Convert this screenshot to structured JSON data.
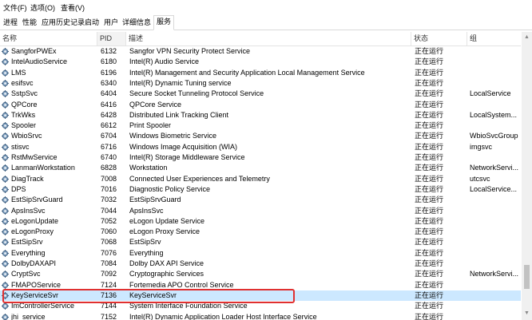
{
  "menu": {
    "file": "文件(F)",
    "options": "选项(O)",
    "view": "查看(V)"
  },
  "tabs": [
    "进程",
    "性能",
    "应用历史记录",
    "启动",
    "用户",
    "详细信息",
    "服务"
  ],
  "columns": {
    "name": "名称",
    "pid": "PID",
    "desc": "描述",
    "status": "状态",
    "group": "组"
  },
  "rows": [
    {
      "name": "SangforPWEx",
      "pid": "6132",
      "desc": "Sangfor VPN Security Protect Service",
      "status": "正在运行",
      "group": ""
    },
    {
      "name": "IntelAudioService",
      "pid": "6180",
      "desc": "Intel(R) Audio Service",
      "status": "正在运行",
      "group": ""
    },
    {
      "name": "LMS",
      "pid": "6196",
      "desc": "Intel(R) Management and Security Application Local Management Service",
      "status": "正在运行",
      "group": ""
    },
    {
      "name": "esifsvc",
      "pid": "6340",
      "desc": "Intel(R) Dynamic Tuning service",
      "status": "正在运行",
      "group": ""
    },
    {
      "name": "SstpSvc",
      "pid": "6404",
      "desc": "Secure Socket Tunneling Protocol Service",
      "status": "正在运行",
      "group": "LocalService"
    },
    {
      "name": "QPCore",
      "pid": "6416",
      "desc": "QPCore Service",
      "status": "正在运行",
      "group": ""
    },
    {
      "name": "TrkWks",
      "pid": "6428",
      "desc": "Distributed Link Tracking Client",
      "status": "正在运行",
      "group": "LocalSystem..."
    },
    {
      "name": "Spooler",
      "pid": "6612",
      "desc": "Print Spooler",
      "status": "正在运行",
      "group": ""
    },
    {
      "name": "WbioSrvc",
      "pid": "6704",
      "desc": "Windows Biometric Service",
      "status": "正在运行",
      "group": "WbioSvcGroup"
    },
    {
      "name": "stisvc",
      "pid": "6716",
      "desc": "Windows Image Acquisition (WIA)",
      "status": "正在运行",
      "group": "imgsvc"
    },
    {
      "name": "RstMwService",
      "pid": "6740",
      "desc": "Intel(R) Storage Middleware Service",
      "status": "正在运行",
      "group": ""
    },
    {
      "name": "LanmanWorkstation",
      "pid": "6828",
      "desc": "Workstation",
      "status": "正在运行",
      "group": "NetworkServi..."
    },
    {
      "name": "DiagTrack",
      "pid": "7008",
      "desc": "Connected User Experiences and Telemetry",
      "status": "正在运行",
      "group": "utcsvc"
    },
    {
      "name": "DPS",
      "pid": "7016",
      "desc": "Diagnostic Policy Service",
      "status": "正在运行",
      "group": "LocalService..."
    },
    {
      "name": "EstSipSrvGuard",
      "pid": "7032",
      "desc": "EstSipSrvGuard",
      "status": "正在运行",
      "group": ""
    },
    {
      "name": "ApsInsSvc",
      "pid": "7044",
      "desc": "ApsInsSvc",
      "status": "正在运行",
      "group": ""
    },
    {
      "name": "eLogonUpdate",
      "pid": "7052",
      "desc": "eLogon Update Service",
      "status": "正在运行",
      "group": ""
    },
    {
      "name": "eLogonProxy",
      "pid": "7060",
      "desc": "eLogon Proxy Service",
      "status": "正在运行",
      "group": ""
    },
    {
      "name": "EstSipSrv",
      "pid": "7068",
      "desc": "EstSipSrv",
      "status": "正在运行",
      "group": ""
    },
    {
      "name": "Everything",
      "pid": "7076",
      "desc": "Everything",
      "status": "正在运行",
      "group": ""
    },
    {
      "name": "DolbyDAXAPI",
      "pid": "7084",
      "desc": "Dolby DAX API Service",
      "status": "正在运行",
      "group": ""
    },
    {
      "name": "CryptSvc",
      "pid": "7092",
      "desc": "Cryptographic Services",
      "status": "正在运行",
      "group": "NetworkServi..."
    },
    {
      "name": "FMAPOService",
      "pid": "7124",
      "desc": "Fortemedia APO Control Service",
      "status": "正在运行",
      "group": ""
    },
    {
      "name": "KeyServiceSvr",
      "pid": "7136",
      "desc": "KeyServiceSvr",
      "status": "正在运行",
      "group": ""
    },
    {
      "name": "ImControllerService",
      "pid": "7144",
      "desc": "System Interface Foundation Service",
      "status": "正在运行",
      "group": ""
    },
    {
      "name": "jhi_service",
      "pid": "7152",
      "desc": "Intel(R) Dynamic Application Loader Host Interface Service",
      "status": "正在运行",
      "group": ""
    }
  ],
  "selected_row": 23,
  "colors": {
    "selected": "#cce8ff",
    "highlight": "#e03030"
  }
}
